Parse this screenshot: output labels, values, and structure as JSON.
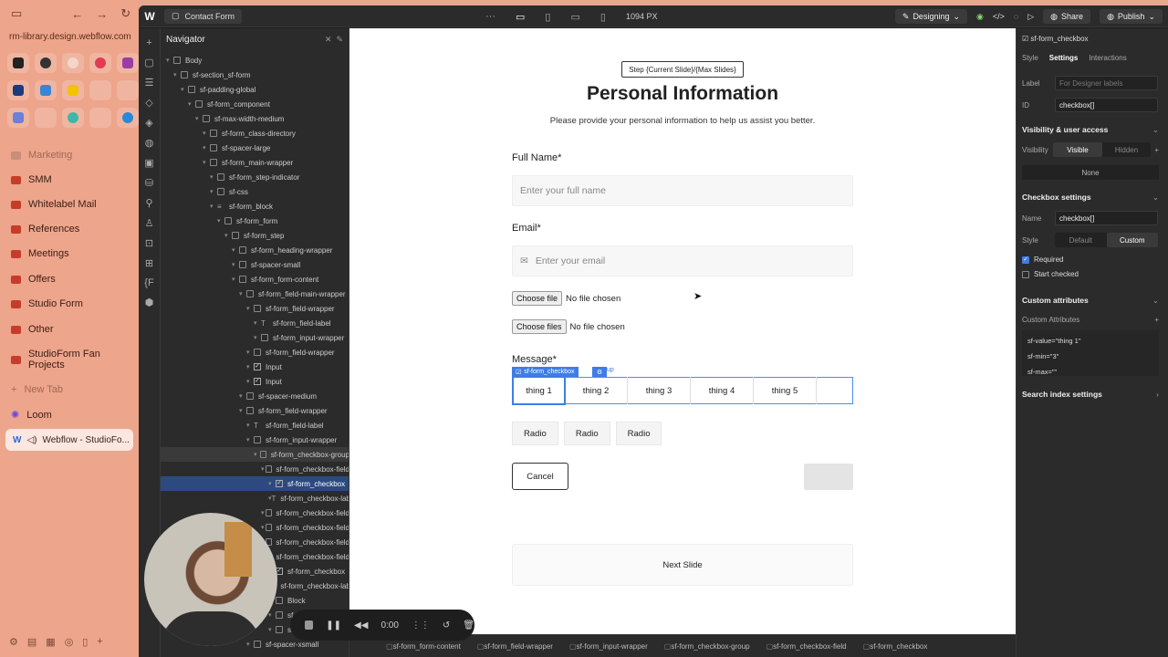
{
  "browser": {
    "url": "rm-library.design.webflow.com",
    "folders": [
      "Marketing",
      "SMM",
      "Whitelabel Mail",
      "References",
      "Meetings",
      "Offers",
      "Studio Form",
      "Other",
      "StudioForm Fan Projects"
    ],
    "new_tab": "New Tab",
    "loom": "Loom",
    "active_tab": "Webflow - StudioFo..."
  },
  "topbar": {
    "page": "Contact Form",
    "width": "1094 PX",
    "mode": "Designing",
    "share": "Share",
    "publish": "Publish"
  },
  "navigator": {
    "title": "Navigator",
    "tree": [
      {
        "label": "Body",
        "d": 0,
        "t": "box"
      },
      {
        "label": "sf-section_sf-form",
        "d": 1,
        "t": "box"
      },
      {
        "label": "sf-padding-global",
        "d": 2,
        "t": "box"
      },
      {
        "label": "sf-form_component",
        "d": 3,
        "t": "box"
      },
      {
        "label": "sf-max-width-medium",
        "d": 4,
        "t": "box"
      },
      {
        "label": "sf-form_class-directory",
        "d": 5,
        "t": "box"
      },
      {
        "label": "sf-spacer-large",
        "d": 5,
        "t": "box"
      },
      {
        "label": "sf-form_main-wrapper",
        "d": 5,
        "t": "box"
      },
      {
        "label": "sf-form_step-indicator",
        "d": 6,
        "t": "box"
      },
      {
        "label": "sf-css",
        "d": 6,
        "t": "embed"
      },
      {
        "label": "sf-form_block",
        "d": 6,
        "t": "form"
      },
      {
        "label": "sf-form_form",
        "d": 7,
        "t": "box"
      },
      {
        "label": "sf-form_step",
        "d": 8,
        "t": "box"
      },
      {
        "label": "sf-form_heading-wrapper",
        "d": 9,
        "t": "box"
      },
      {
        "label": "sf-spacer-small",
        "d": 9,
        "t": "box"
      },
      {
        "label": "sf-form_form-content",
        "d": 9,
        "t": "box"
      },
      {
        "label": "sf-form_field-main-wrapper",
        "d": 10,
        "t": "box"
      },
      {
        "label": "sf-form_field-wrapper",
        "d": 11,
        "t": "box"
      },
      {
        "label": "sf-form_field-label",
        "d": 12,
        "t": "text"
      },
      {
        "label": "sf-form_input-wrapper",
        "d": 12,
        "t": "box"
      },
      {
        "label": "sf-form_field-wrapper",
        "d": 11,
        "t": "box"
      },
      {
        "label": "Input",
        "d": 11,
        "t": "cb"
      },
      {
        "label": "Input",
        "d": 11,
        "t": "cb"
      },
      {
        "label": "sf-spacer-medium",
        "d": 10,
        "t": "box"
      },
      {
        "label": "sf-form_field-wrapper",
        "d": 10,
        "t": "box"
      },
      {
        "label": "sf-form_field-label",
        "d": 11,
        "t": "text"
      },
      {
        "label": "sf-form_input-wrapper",
        "d": 11,
        "t": "box"
      },
      {
        "label": "sf-form_checkbox-group",
        "d": 12,
        "t": "box",
        "hov": true
      },
      {
        "label": "sf-form_checkbox-field",
        "d": 13,
        "t": "box"
      },
      {
        "label": "sf-form_checkbox",
        "d": 14,
        "t": "cb",
        "sel": true
      },
      {
        "label": "sf-form_checkbox-lab",
        "d": 14,
        "t": "text"
      },
      {
        "label": "sf-form_checkbox-field",
        "d": 13,
        "t": "box"
      },
      {
        "label": "sf-form_checkbox-field",
        "d": 13,
        "t": "box"
      },
      {
        "label": "sf-form_checkbox-field",
        "d": 13,
        "t": "box"
      },
      {
        "label": "sf-form_checkbox-field",
        "d": 13,
        "t": "box"
      },
      {
        "label": "sf-form_checkbox",
        "d": 14,
        "t": "cb"
      },
      {
        "label": "sf-form_checkbox-lab",
        "d": 14,
        "t": "text"
      },
      {
        "label": "Block",
        "d": 14,
        "t": "box"
      },
      {
        "label": "sf-form",
        "d": 14,
        "t": "box"
      },
      {
        "label": "sf-form",
        "d": 14,
        "t": "box"
      },
      {
        "label": "sf-spacer-xsmall",
        "d": 11,
        "t": "box"
      }
    ]
  },
  "form": {
    "step_indicator": "Step {Current Slide}/{Max Slides}",
    "title": "Personal Information",
    "subtitle": "Please provide your personal information to help us assist you better.",
    "name_label": "Full Name*",
    "name_placeholder": "Enter your full name",
    "email_label": "Email*",
    "email_placeholder": "Enter your email",
    "file1_btn": "Choose file",
    "file1_status": "No file chosen",
    "file2_btn": "Choose files",
    "file2_status": "No file chosen",
    "message_label": "Message*",
    "selected_badge": "sf-form_checkbox",
    "badge_tail": "up",
    "checkboxes": [
      "thing 1",
      "thing 2",
      "thing 3",
      "thing 4",
      "thing 5"
    ],
    "radios": [
      "Radio",
      "Radio",
      "Radio"
    ],
    "cancel": "Cancel",
    "next_slide": "Next Slide"
  },
  "breadcrumb": [
    "sf-form_form-content",
    "sf-form_field-wrapper",
    "sf-form_input-wrapper",
    "sf-form_checkbox-group",
    "sf-form_checkbox-field",
    "sf-form_checkbox"
  ],
  "settings": {
    "selected": "sf-form_checkbox",
    "tabs": [
      "Style",
      "Settings",
      "Interactions"
    ],
    "label_key": "Label",
    "label_placeholder": "For Designer labels",
    "id_key": "ID",
    "id_value": "checkbox[]",
    "vis_title": "Visibility & user access",
    "vis_key": "Visibility",
    "vis_visible": "Visible",
    "vis_hidden": "Hidden",
    "vis_none": "None",
    "cb_title": "Checkbox settings",
    "name_key": "Name",
    "name_value": "checkbox[]",
    "style_key": "Style",
    "style_default": "Default",
    "style_custom": "Custom",
    "required": "Required",
    "start_checked": "Start checked",
    "ca_title": "Custom attributes",
    "ca_sub": "Custom Attributes",
    "attrs": [
      "sf-value=\"thing 1\"",
      "sf-min=\"3\"",
      "sf-max=\"\""
    ],
    "search_title": "Search index settings"
  },
  "recorder": {
    "time": "0:00"
  }
}
